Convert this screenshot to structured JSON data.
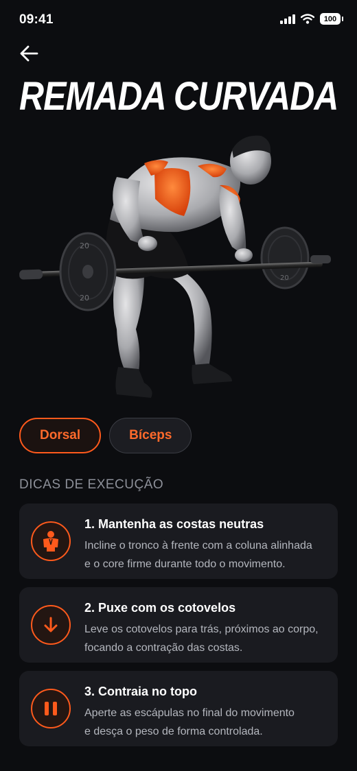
{
  "status": {
    "time": "09:41",
    "battery": "100"
  },
  "header": {
    "title": "REMADA CURVADA"
  },
  "hero": {
    "plate_label": "20"
  },
  "muscles": [
    {
      "label": "Dorsal",
      "style": "primary"
    },
    {
      "label": "Bíceps",
      "style": "secondary"
    }
  ],
  "section": {
    "title": "DICAS DE EXECUÇÃO"
  },
  "tips": [
    {
      "icon": "person-icon",
      "title": "1. Mantenha as costas neutras",
      "line1": "Incline o tronco à frente com a coluna alinhada",
      "line2": "e o core firme durante todo o movimento."
    },
    {
      "icon": "arrow-down-icon",
      "title": "2. Puxe com os cotovelos",
      "line1": "Leve os cotovelos para trás, próximos ao corpo,",
      "line2": "focando a contração das costas."
    },
    {
      "icon": "pause-icon",
      "title": "3. Contraia no topo",
      "line1": "Aperte as escápulas no final do movimento",
      "line2": "e desça o peso de forma controlada."
    }
  ],
  "colors": {
    "accent": "#ff5a1c",
    "background": "#0c0d10",
    "card": "#1a1b20"
  }
}
